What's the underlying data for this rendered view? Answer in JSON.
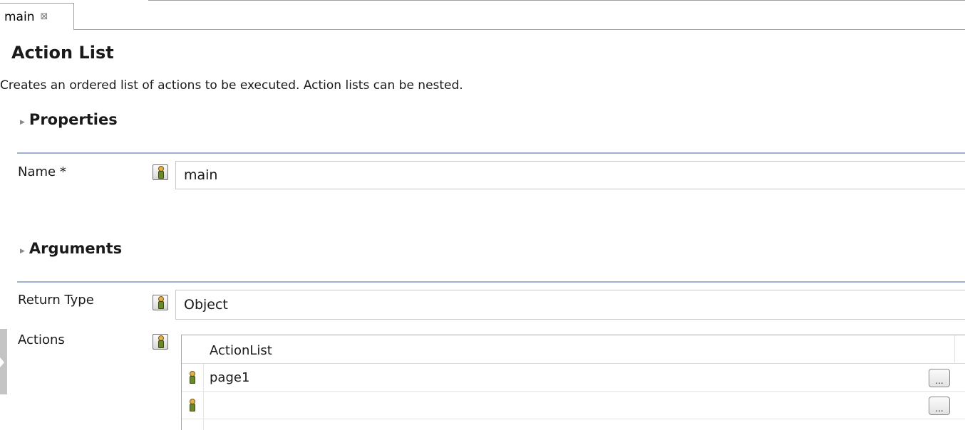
{
  "editor_tab": {
    "label": "main",
    "close_glyph": "⊠"
  },
  "header": {
    "title": "Action List",
    "description": "Creates an ordered list of actions to be executed. Action lists can be nested."
  },
  "sections": {
    "properties": {
      "title": "Properties",
      "fields": {
        "name": {
          "label": "Name *",
          "value": "main",
          "icon": "person-icon"
        }
      }
    },
    "arguments": {
      "title": "Arguments",
      "fields": {
        "return_type": {
          "label": "Return Type",
          "value": "Object",
          "icon": "person-icon"
        },
        "actions": {
          "label": "Actions",
          "icon": "person-icon",
          "table": {
            "column_header": "ActionList",
            "rows": [
              {
                "value": "page1",
                "button_label": "..."
              },
              {
                "value": "",
                "button_label": "..."
              }
            ]
          }
        }
      }
    }
  },
  "colors": {
    "section_rule": "#9fb0d0",
    "border": "#a0a0a0"
  }
}
